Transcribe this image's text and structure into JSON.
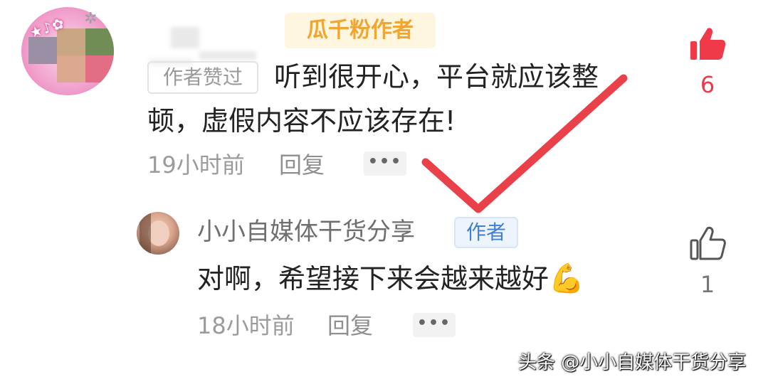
{
  "comment": {
    "fan_badge": "瓜千粉作者",
    "liked_badge": "作者赞过",
    "text_line1": "听到很开心，平台就应该整",
    "text_line2": "顿，虚假内容不应该存在!",
    "time": "19小时前",
    "reply_label": "回复",
    "more_label": "•••",
    "like_count": "6",
    "like_color": "#f03a4a"
  },
  "reply": {
    "author_name": "小小自媒体干货分享",
    "author_badge": "作者",
    "text": "对啊，希望接下来会越来越好",
    "emoji": "💪",
    "time": "18小时前",
    "reply_label": "回复",
    "more_label": "•••",
    "like_count": "1"
  },
  "watermark": "头条 @小小自媒体干货分享",
  "overlay": {
    "checkmark_color": "#e8303a"
  }
}
